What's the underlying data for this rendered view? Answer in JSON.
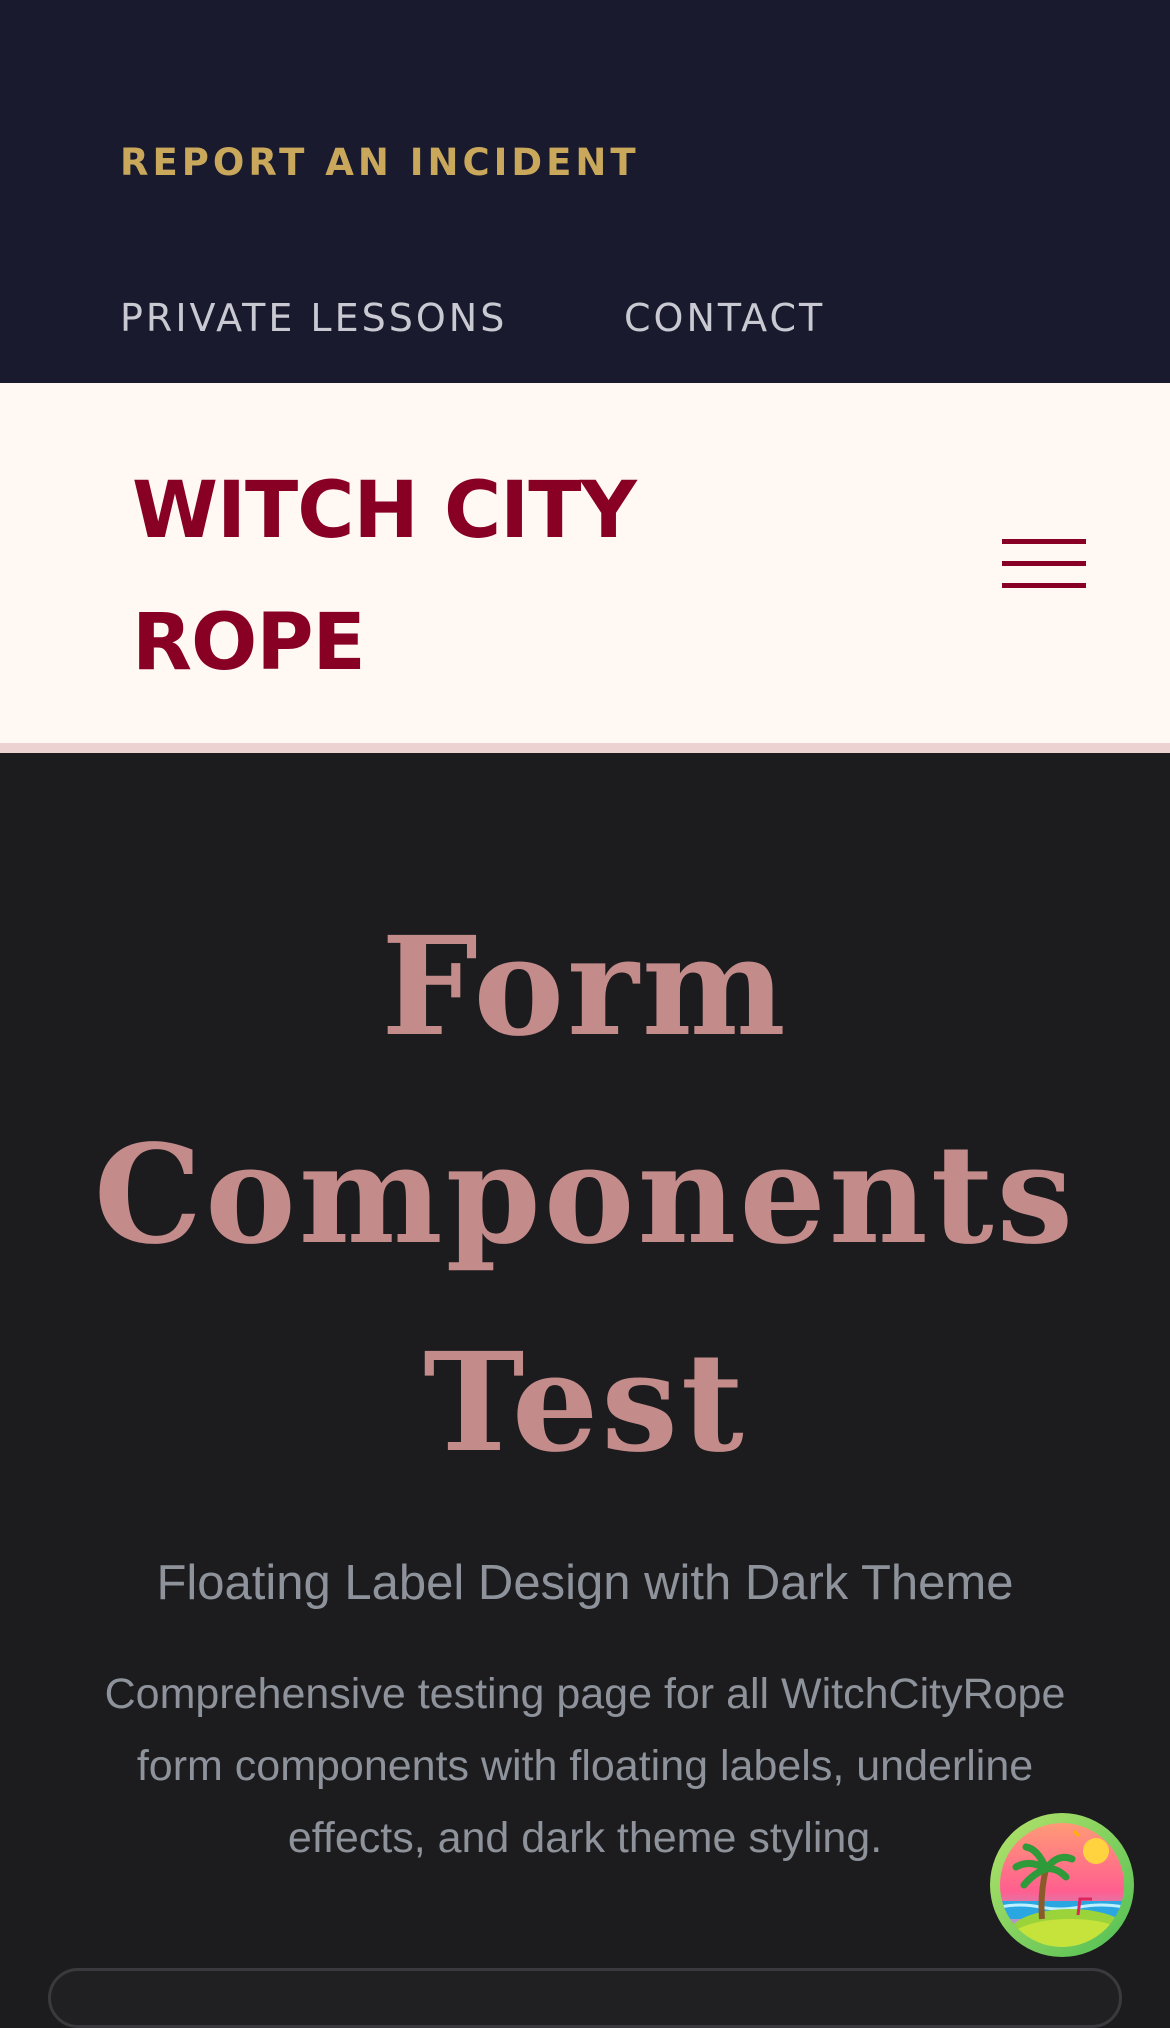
{
  "top_nav": {
    "report_incident": "REPORT AN INCIDENT",
    "private_lessons": "PRIVATE LESSONS",
    "contact": "CONTACT"
  },
  "header": {
    "brand": "WITCH CITY ROPE",
    "menu_icon": "hamburger-menu-icon"
  },
  "hero": {
    "title": "Form Components Test",
    "subtitle": "Floating Label Design with Dark Theme",
    "description": "Comprehensive testing page for all WitchCityRope form components with floating labels, underline effects, and dark theme styling."
  },
  "floating_button": {
    "icon": "island-beach-icon"
  },
  "colors": {
    "nav_background": "#1a1a2e",
    "report_accent": "#c9a85c",
    "nav_text": "#c9c9d2",
    "header_background": "#fff8f3",
    "brand_color": "#880124",
    "page_background": "#1c1c1e",
    "hero_title": "#c48b8b",
    "hero_muted_text": "#8d929b"
  }
}
